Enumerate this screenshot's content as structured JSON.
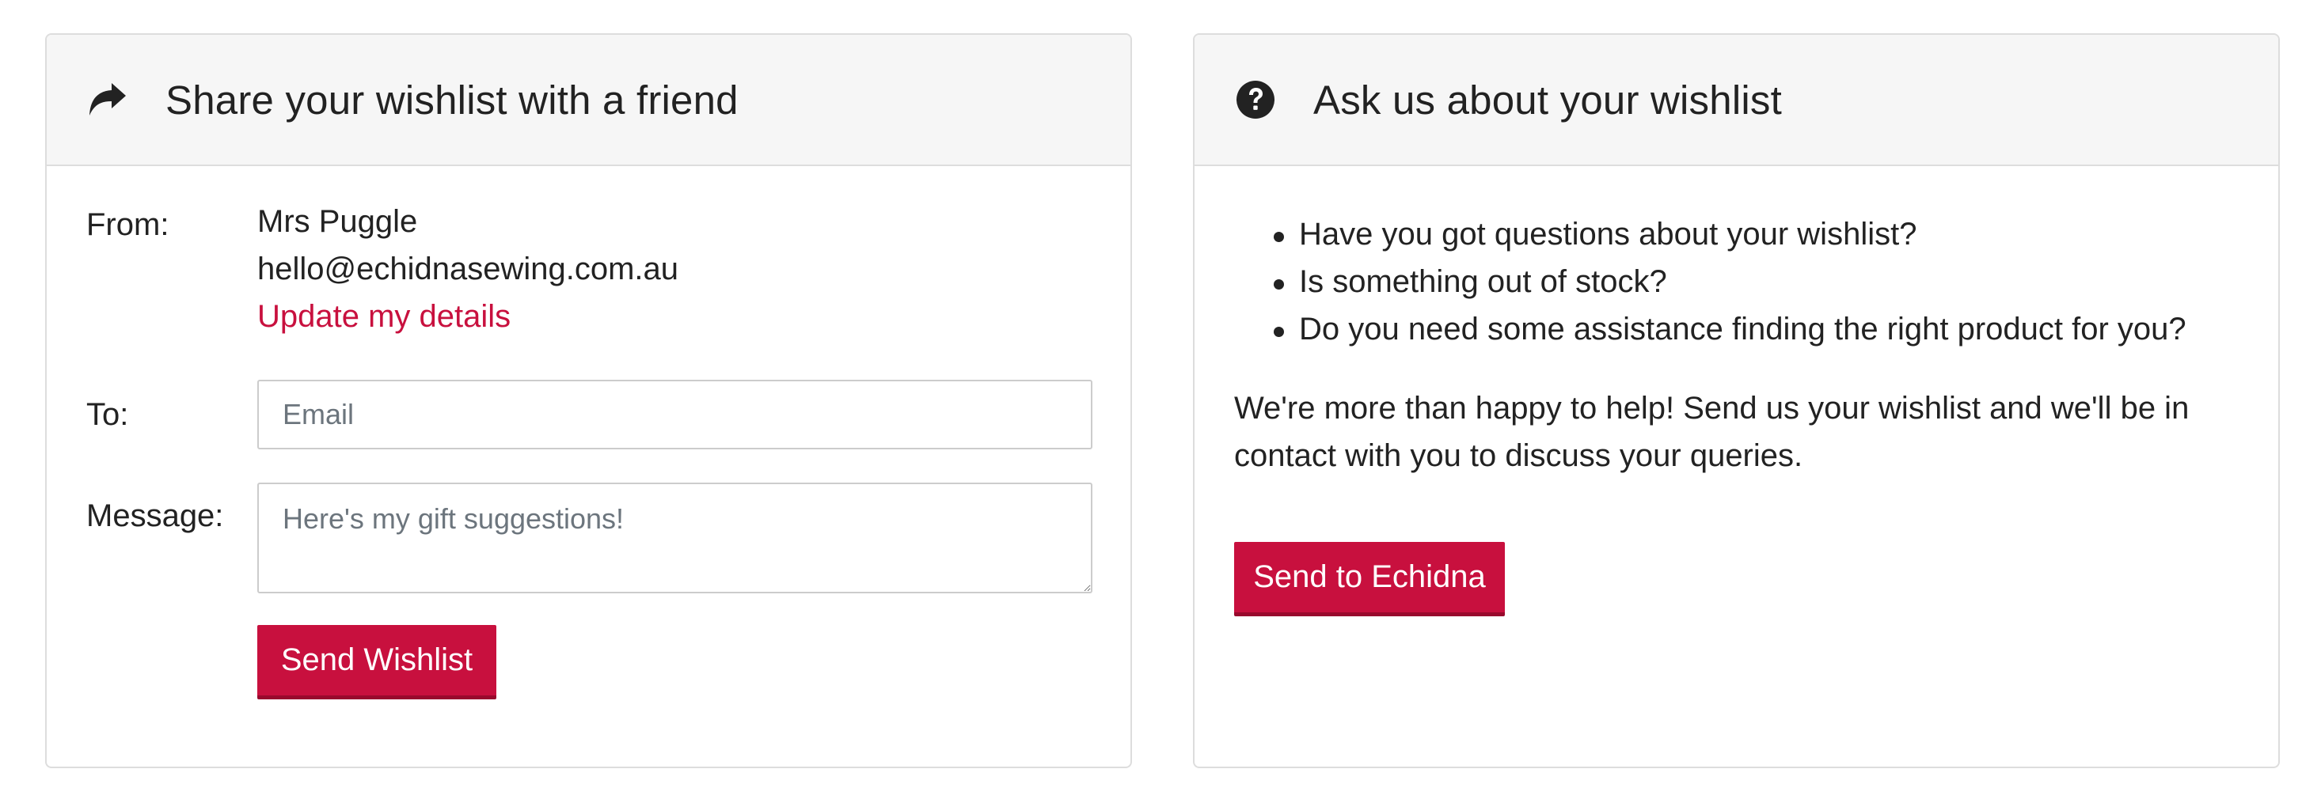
{
  "share_panel": {
    "icon": "share-arrow-icon",
    "title": "Share your wishlist with a friend",
    "from_label": "From:",
    "from_name": "Mrs Puggle",
    "from_email": "hello@echidnasewing.com.au",
    "update_link": "Update my details",
    "to_label": "To:",
    "email_placeholder": "Email",
    "email_value": "",
    "message_label": "Message:",
    "message_placeholder": "Here's my gift suggestions!",
    "message_value": "",
    "send_button": "Send Wishlist"
  },
  "ask_panel": {
    "icon": "question-circle-icon",
    "title": "Ask us about your wishlist",
    "bullets": [
      "Have you got questions about your wishlist?",
      "Is something out of stock?",
      "Do you need some assistance finding the right product for you?"
    ],
    "paragraph": "We're more than happy to help! Send us your wishlist and we'll be in contact with you to discuss your queries.",
    "send_button": "Send to Echidna"
  },
  "colors": {
    "accent": "#c8103e",
    "header_bg": "#f6f6f6",
    "border": "#dddddd",
    "text": "#222222"
  }
}
